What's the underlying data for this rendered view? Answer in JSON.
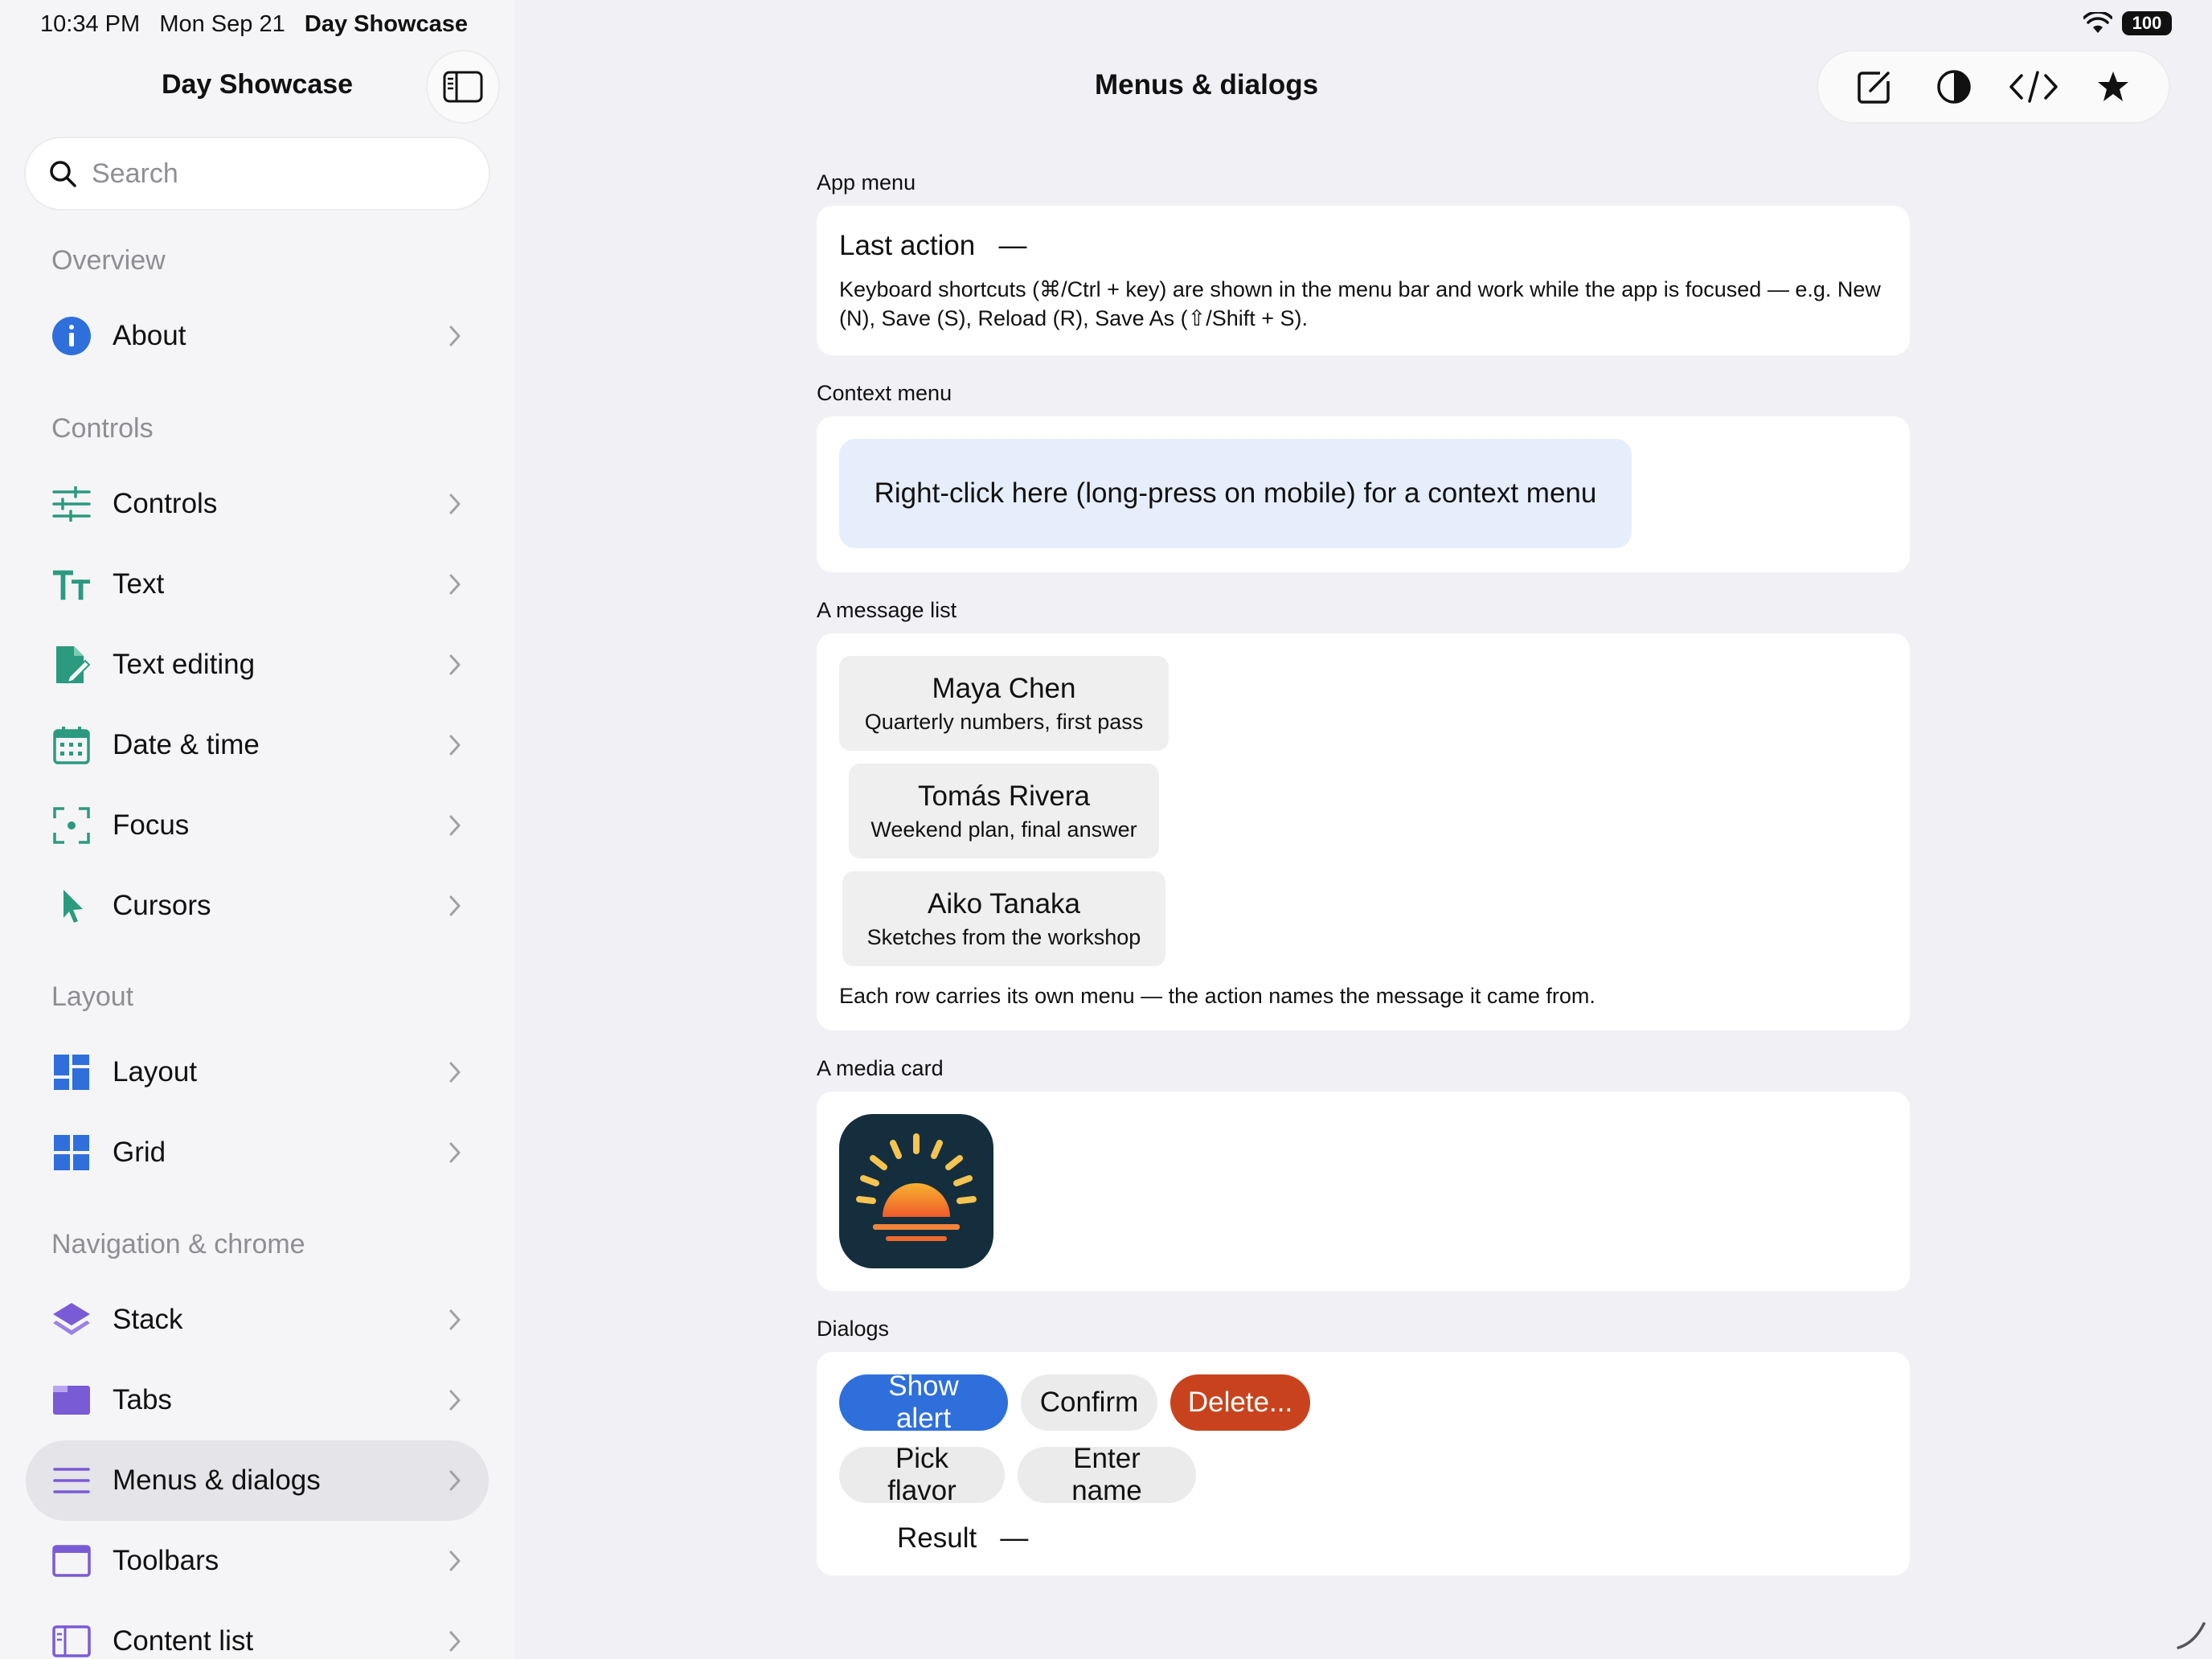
{
  "status_bar": {
    "time": "10:34 PM",
    "date": "Mon Sep 21",
    "app": "Day Showcase",
    "battery": "100"
  },
  "sidebar": {
    "title": "Day Showcase",
    "search_placeholder": "Search",
    "sections": {
      "overview": "Overview",
      "controls": "Controls",
      "layout": "Layout",
      "navigation": "Navigation & chrome"
    },
    "items": {
      "about": "About",
      "controls": "Controls",
      "text": "Text",
      "text_editing": "Text editing",
      "date_time": "Date & time",
      "focus": "Focus",
      "cursors": "Cursors",
      "layout": "Layout",
      "grid": "Grid",
      "stack": "Stack",
      "tabs": "Tabs",
      "menus_dialogs": "Menus & dialogs",
      "toolbars": "Toolbars",
      "content_list": "Content list"
    },
    "selected": "Menus & dialogs"
  },
  "main": {
    "title": "Menus & dialogs",
    "app_menu": {
      "label": "App menu",
      "last_action_label": "Last action",
      "last_action_value": "—",
      "hint": "Keyboard shortcuts (⌘/Ctrl + key) are shown in the menu bar and work while the app is focused — e.g. New (N), Save (S), Reload (R), Save As (⇧/Shift + S)."
    },
    "context_menu": {
      "label": "Context menu",
      "target_text": "Right-click here (long-press on mobile) for a context menu"
    },
    "message_list": {
      "label": "A message list",
      "messages": [
        {
          "name": "Maya Chen",
          "subject": "Quarterly numbers, first pass"
        },
        {
          "name": "Tomás Rivera",
          "subject": "Weekend plan, final answer"
        },
        {
          "name": "Aiko Tanaka",
          "subject": "Sketches from the workshop"
        }
      ],
      "note": "Each row carries its own menu — the action names the message it came from."
    },
    "media_card": {
      "label": "A media card"
    },
    "dialogs": {
      "label": "Dialogs",
      "buttons": {
        "show_alert": "Show alert",
        "confirm": "Confirm",
        "delete": "Delete...",
        "pick_flavor": "Pick flavor",
        "enter_name": "Enter name"
      },
      "result_label": "Result",
      "result_value": "—"
    }
  },
  "colors": {
    "accent_blue": "#2f6fdc",
    "danger": "#c8431d",
    "context_bg": "#e6edfb",
    "sidebar_bg": "#f5f5f7",
    "main_bg": "#f1f0f5",
    "teal_icon": "#2b9a7f",
    "purple_icon": "#7a5bd6",
    "blue_icon": "#2f6fdc"
  }
}
